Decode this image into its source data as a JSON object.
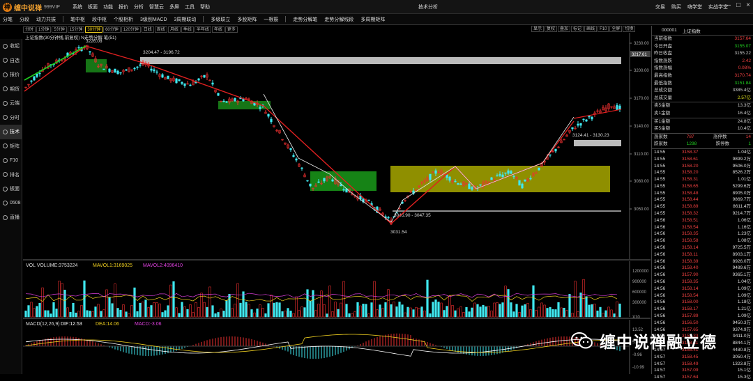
{
  "app": {
    "name": "缠中说禅",
    "edition": "999VIP",
    "window_title": "技术分析"
  },
  "top_menu": [
    "系统",
    "板面",
    "功能",
    "报价",
    "分析",
    "智慧云",
    "多屏",
    "工具",
    "帮助"
  ],
  "right_menu": [
    "交易",
    "购买",
    "嗨学堂",
    "实战学堂"
  ],
  "nav": [
    [
      "分笔",
      "分段",
      "动力共振"
    ],
    [
      "笔中枢",
      "段中枢",
      "个股相析",
      "3级别MACD",
      "3周期联动"
    ],
    [
      "多级联立",
      "多股矩阵",
      "一根筋"
    ],
    [
      "走势分解笔",
      "走势分解线段",
      "多周期矩阵"
    ]
  ],
  "sidebar": [
    {
      "label": "收起",
      "icon": "collapse-icon"
    },
    {
      "label": "自选",
      "icon": "star-icon"
    },
    {
      "label": "报价",
      "icon": "quote-icon"
    },
    {
      "label": "期货",
      "icon": "futures-icon"
    },
    {
      "label": "云端",
      "icon": "cloud-icon"
    },
    {
      "label": "分时",
      "icon": "clock-icon"
    },
    {
      "label": "技术",
      "icon": "chart-icon",
      "active": true
    },
    {
      "label": "矩阵",
      "icon": "grid-icon"
    },
    {
      "label": "F10",
      "icon": "doc-icon"
    },
    {
      "label": "排名",
      "icon": "rank-icon"
    },
    {
      "label": "板面",
      "icon": "panel-icon"
    },
    {
      "label": "0508",
      "icon": "date-icon"
    },
    {
      "label": "直播",
      "icon": "live-icon"
    }
  ],
  "periods": [
    "分时",
    "1分钟",
    "5分钟",
    "15分钟",
    "30分钟",
    "60分钟",
    "120分钟",
    "日线",
    "周线",
    "月线",
    "季线",
    "半年线",
    "年线",
    "更多"
  ],
  "active_period": "30分钟",
  "view_tabs": [
    "显示",
    "复权",
    "叠加",
    "标记",
    "画线",
    "F10",
    "全屏",
    "切换"
  ],
  "index_info": "上证指数(30分钟线,前复权) N走势分解 笔(51)",
  "price_axis": {
    "labels": [
      "3230.00",
      "3200.00",
      "3170.00",
      "3140.00",
      "3110.00",
      "3080.00",
      "3050.00"
    ],
    "current": "3217.61"
  },
  "chart_annotations": {
    "high_label": "3226.08",
    "low_label": "3031.54",
    "zone1": "3204.47 - 3196.72",
    "zone2": "3124.41 - 3130.23",
    "zone3": "3045.90 - 3047.35"
  },
  "volume": {
    "title": "VOL VOLUME:3753224",
    "mavol1": "MAVOL1:3169025",
    "mavol2": "MAVOL2:4096410",
    "axis": [
      "1200000",
      "900000",
      "600000",
      "300000"
    ],
    "unit": "X10"
  },
  "macd": {
    "title": "MACD(12,26,9)",
    "dif": "DIF:12.53",
    "dea": "DEA:14.06",
    "macd": "MACD:-3.06",
    "axis": [
      "13.52",
      "5.00",
      "-0.96",
      "-10.99"
    ]
  },
  "quote": {
    "code": "000001",
    "name": "上证指数",
    "rows": [
      {
        "label": "当前指数",
        "value": "3157.64",
        "color": "red"
      },
      {
        "label": "今日开盘",
        "value": "3155.07",
        "color": "grn"
      },
      {
        "label": "昨日收盘",
        "value": "3155.22",
        "color": ""
      },
      {
        "label": "指数涨跌",
        "value": "2.42",
        "color": "red"
      },
      {
        "label": "指数涨幅",
        "value": "0.08%",
        "color": "red"
      },
      {
        "label": "最高指数",
        "value": "3170.74",
        "color": "red"
      },
      {
        "label": "最低指数",
        "value": "3151.84",
        "color": "grn"
      },
      {
        "label": "总成交额",
        "value": "3385.4亿",
        "color": ""
      },
      {
        "label": "总成交量",
        "value": "2.57亿",
        "color": "yel"
      },
      {
        "label": "卖5金额",
        "value": "13.3亿",
        "color": ""
      },
      {
        "label": "卖1金额",
        "value": "16.4亿",
        "color": ""
      },
      {
        "label": "买1金额",
        "value": "24.8亿",
        "color": ""
      },
      {
        "label": "买5金额",
        "value": "10.4亿",
        "color": ""
      }
    ],
    "stats": {
      "up_label": "涨家数",
      "up": "787",
      "limit_up_label": "涨停数",
      "limit_up": "14",
      "down_label": "跌家数",
      "down": "1298",
      "limit_down_label": "跌停数",
      "limit_down": "1"
    }
  },
  "ticks": [
    [
      "14:55",
      "3158.37",
      "1.04亿"
    ],
    [
      "14:55",
      "3158.61",
      "9899.2万"
    ],
    [
      "14:55",
      "3158.20",
      "9506.0万"
    ],
    [
      "14:55",
      "3158.20",
      "8526.2万"
    ],
    [
      "14:55",
      "3158.31",
      "1.01亿"
    ],
    [
      "14:55",
      "3158.65",
      "5299.6万"
    ],
    [
      "14:55",
      "3158.48",
      "8905.0万"
    ],
    [
      "14:55",
      "3158.44",
      "9869.7万"
    ],
    [
      "14:55",
      "3158.89",
      "8611.4万"
    ],
    [
      "14:55",
      "3158.32",
      "9214.7万"
    ],
    [
      "14:56",
      "3158.51",
      "1.06亿"
    ],
    [
      "14:56",
      "3158.54",
      "1.16亿"
    ],
    [
      "14:56",
      "3158.35",
      "1.23亿"
    ],
    [
      "14:56",
      "3158.58",
      "1.08亿"
    ],
    [
      "14:56",
      "3158.14",
      "9725.5万"
    ],
    [
      "14:56",
      "3158.11",
      "8903.1万"
    ],
    [
      "14:56",
      "3158.39",
      "8926.0万"
    ],
    [
      "14:56",
      "3158.40",
      "9489.6万"
    ],
    [
      "14:56",
      "3157.90",
      "9365.1万"
    ],
    [
      "14:56",
      "3158.35",
      "1.04亿"
    ],
    [
      "14:56",
      "3158.14",
      "1.09亿"
    ],
    [
      "14:56",
      "3158.54",
      "1.09亿"
    ],
    [
      "14:56",
      "3158.00",
      "1.18亿"
    ],
    [
      "14:56",
      "3158.17",
      "1.21亿"
    ],
    [
      "14:56",
      "3157.89",
      "1.09亿"
    ],
    [
      "14:56",
      "3156.50",
      "9450.3万"
    ],
    [
      "14:56",
      "3157.65",
      "9374.9万"
    ],
    [
      "14:56",
      "3158.33",
      "9411.0万"
    ],
    [
      "14:56",
      "3158.31",
      "8844.1万"
    ],
    [
      "14:57",
      "3158.41",
      "4480.8万"
    ],
    [
      "14:57",
      "3158.45",
      "3050.4万"
    ],
    [
      "14:57",
      "3158.49",
      "1323.8万"
    ],
    [
      "14:57",
      "3157.09",
      "15.1亿"
    ],
    [
      "14:57",
      "3157.64",
      "15.3亿"
    ]
  ],
  "watermark": "缠中说禅融立德",
  "colors": {
    "up": "#ee4040",
    "down": "#40e8f0",
    "stroke": "#d02020",
    "center_green": "#20c020",
    "center_yellow": "#b0b000"
  }
}
